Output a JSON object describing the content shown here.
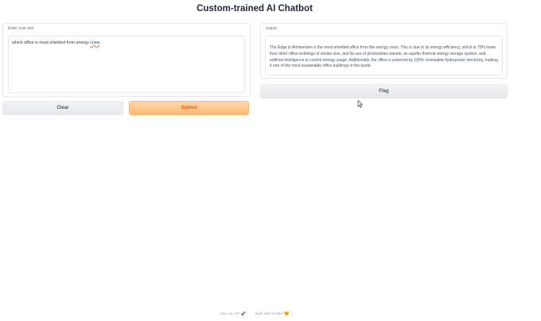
{
  "app": {
    "title": "Custom-trained AI Chatbot"
  },
  "input": {
    "label": "Enter your text",
    "value_prefix": "which office is most shielded from energy ",
    "value_typo": "crisis"
  },
  "output": {
    "label": "output",
    "value": "The Edge in Amsterdam is the most shielded office from the energy crisis. This is due to its energy efficiency, which is 70% lower than other office buildings of similar size, and its use of photovoltaic panels, an aquifer thermal energy storage system, and artificial intelligence to control energy usage. Additionally, the office is powered by 100% renewable hydropower electricity, making it one of the most sustainable office buildings in the world."
  },
  "buttons": {
    "clear": "Clear",
    "submit": "Submit",
    "flag": "Flag"
  },
  "footer": {
    "api_label": "Use via API",
    "api_icon": "🚀",
    "separator": "·",
    "built_label": "Built with Gradio",
    "built_icon": "🧡"
  },
  "colors": {
    "accent": "#fdba74",
    "accent_text": "#ea580c",
    "neutral_button": "#e5e7eb"
  }
}
